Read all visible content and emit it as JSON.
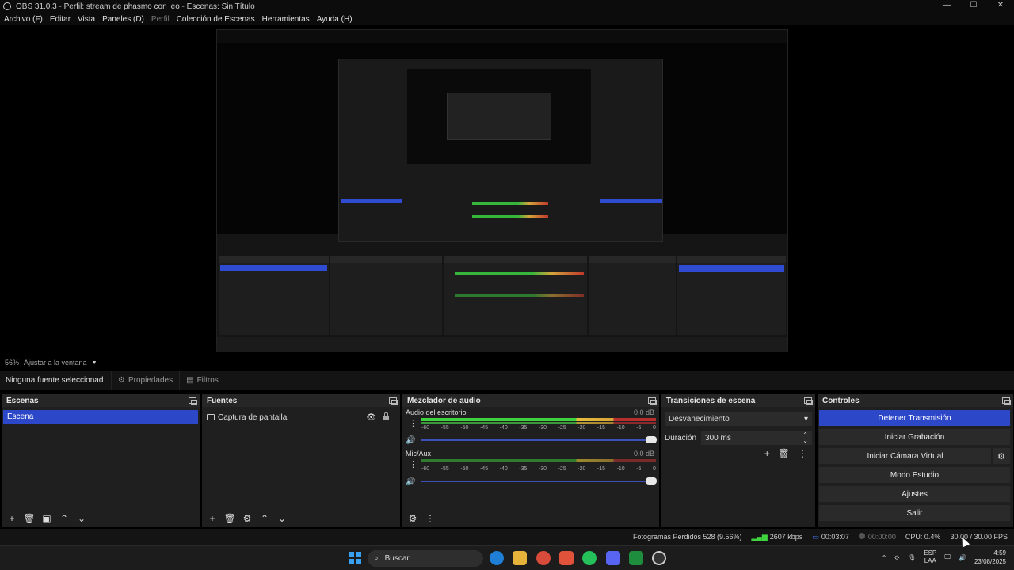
{
  "window": {
    "title": "OBS 31.0.3 - Perfil: stream de phasmo con leo - Escenas: Sin Título",
    "controls": [
      "—",
      "☐",
      "✕"
    ]
  },
  "menu": {
    "items": [
      "Archivo (F)",
      "Editar",
      "Vista",
      "Paneles (D)",
      "Perfil",
      "Colección de Escenas",
      "Herramientas",
      "Ayuda (H)"
    ]
  },
  "preview": {
    "scale_label": "56%",
    "fit_label": "Ajustar a la ventana"
  },
  "context": {
    "no_source": "Ninguna fuente seleccionad",
    "properties": "Propiedades",
    "filters": "Filtros"
  },
  "scenes": {
    "title": "Escenas",
    "items": [
      "Escena"
    ]
  },
  "sources": {
    "title": "Fuentes",
    "items": [
      "Captura de pantalla"
    ]
  },
  "mixer": {
    "title": "Mezclador de audio",
    "channels": [
      {
        "name": "Audio del escritorio",
        "db": "0.0 dB",
        "volume": 1.0
      },
      {
        "name": "Mic/Aux",
        "db": "0.0 dB",
        "volume": 1.0
      }
    ],
    "ticks": [
      "-60",
      "-55",
      "-50",
      "-45",
      "-40",
      "-35",
      "-30",
      "-25",
      "-20",
      "-15",
      "-10",
      "-5",
      "0"
    ]
  },
  "transitions": {
    "title": "Transiciones de escena",
    "selected": "Desvanecimiento",
    "duration_label": "Duración",
    "duration_value": "300 ms"
  },
  "controls": {
    "title": "Controles",
    "stop_stream": "Detener Transmisión",
    "start_recording": "Iniciar Grabación",
    "start_virtual_cam": "Iniciar Cámara Virtual",
    "studio_mode": "Modo Estudio",
    "settings": "Ajustes",
    "exit": "Salir"
  },
  "status": {
    "dropped_frames": "Fotogramas Perdidos 528 (9.56%)",
    "bitrate": "2607 kbps",
    "stream_time": "00:03:07",
    "rec_time": "00:00:00",
    "cpu": "CPU: 0.4%",
    "fps": "30.00 / 30.00 FPS"
  },
  "taskbar": {
    "search_placeholder": "Buscar",
    "lang_top": "ESP",
    "lang_bottom": "LAA",
    "time": "4:59",
    "date": "23/08/2025"
  },
  "colors": {
    "accent": "#2d47c9",
    "meter_green": "#3fd43f",
    "meter_yellow": "#e6c13a",
    "meter_red": "#b62e2e"
  }
}
